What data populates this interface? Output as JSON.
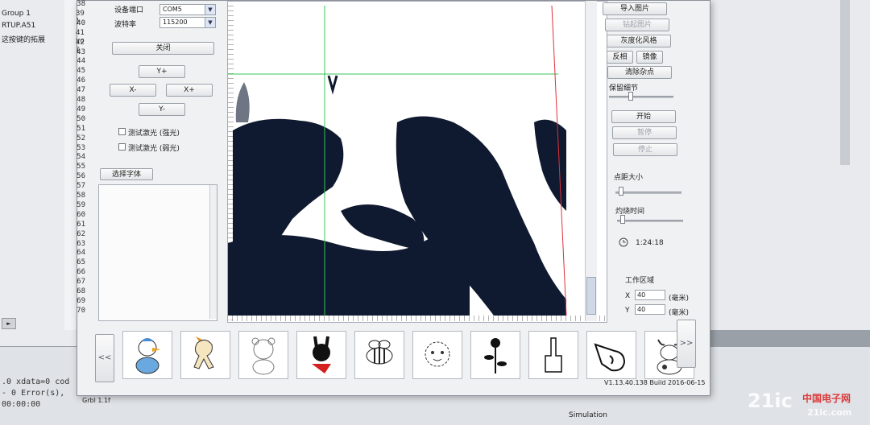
{
  "ide": {
    "tree_items": [
      "Group 1",
      "RTUP.A51",
      "这按键的拓展"
    ],
    "line_numbers": [
      "38",
      "39",
      "40",
      "41",
      "42",
      "43",
      "44",
      "45",
      "46",
      "47",
      "48",
      "49",
      "50",
      "51",
      "52",
      "53",
      "54",
      "55",
      "56",
      "57",
      "58",
      "59",
      "60",
      "61",
      "62",
      "63",
      "64",
      "65",
      "66",
      "67",
      "68",
      "69",
      "70"
    ],
    "line_markers": {
      "39": "}",
      "41": "vo",
      "42": "{"
    },
    "output_lines": [
      ".0 xdata=0 cod",
      "- 0 Error(s),",
      "00:00:00"
    ],
    "status_text": "Simulation"
  },
  "app": {
    "device_port_label": "设备端口",
    "device_port_value": "COM5",
    "baud_label": "波特率",
    "baud_value": "115200",
    "close_button": "关闭",
    "y_plus": "Y+",
    "x_minus": "X-",
    "x_plus": "X+",
    "y_minus": "Y-",
    "test_laser_strong": "测试激光 (强光)",
    "test_laser_weak": "测试激光 (弱光)",
    "select_font_button": "选择字体",
    "import_image_button": "导入图片",
    "disabled_image_button": "钻起图片",
    "grayscale_button": "灰度化风格",
    "invert_button": "反相",
    "mirror_button": "镜像",
    "clear_noise_button": "清除杂点",
    "detail_label": "保留细节",
    "start_button": "开始",
    "pause_button": "暂停",
    "stop_button": "停止",
    "dot_size_label": "点距大小",
    "burn_time_label": "灼烧时间",
    "elapsed_time": "1:24:18",
    "work_area_label": "工作区域",
    "x_label": "X",
    "y_label": "Y",
    "x_value": "40",
    "y_value": "40",
    "unit_mm": "(毫米)",
    "prev_button": "<<",
    "next_button": ">>",
    "version_text": "V1.13.40.138 Build 2016-06-15",
    "firmware_text": "Grbl 1.1f"
  },
  "slider_levels": {
    "detail": 0.3,
    "dot_size": 0.05,
    "burn_time": 0.05
  },
  "thumbnails": [
    {
      "name": "duck",
      "icon": "duck-icon"
    },
    {
      "name": "horse",
      "icon": "horse-icon"
    },
    {
      "name": "bear",
      "icon": "bear-icon"
    },
    {
      "name": "rabbit",
      "icon": "rabbit-icon"
    },
    {
      "name": "bee",
      "icon": "bee-icon"
    },
    {
      "name": "sheep",
      "icon": "sheep-icon"
    },
    {
      "name": "flower",
      "icon": "flower-icon"
    },
    {
      "name": "hand",
      "icon": "hand-gesture-icon"
    },
    {
      "name": "pointing-hand",
      "icon": "pointing-hand-icon"
    },
    {
      "name": "cow",
      "icon": "cow-icon"
    }
  ],
  "watermark": {
    "brand": "21ic",
    "site": "中国电子网",
    "url": "21ic.com"
  },
  "colors": {
    "guide_green": "#34c759",
    "guide_red": "#e0303a",
    "image_dark": "#0f1a30"
  }
}
